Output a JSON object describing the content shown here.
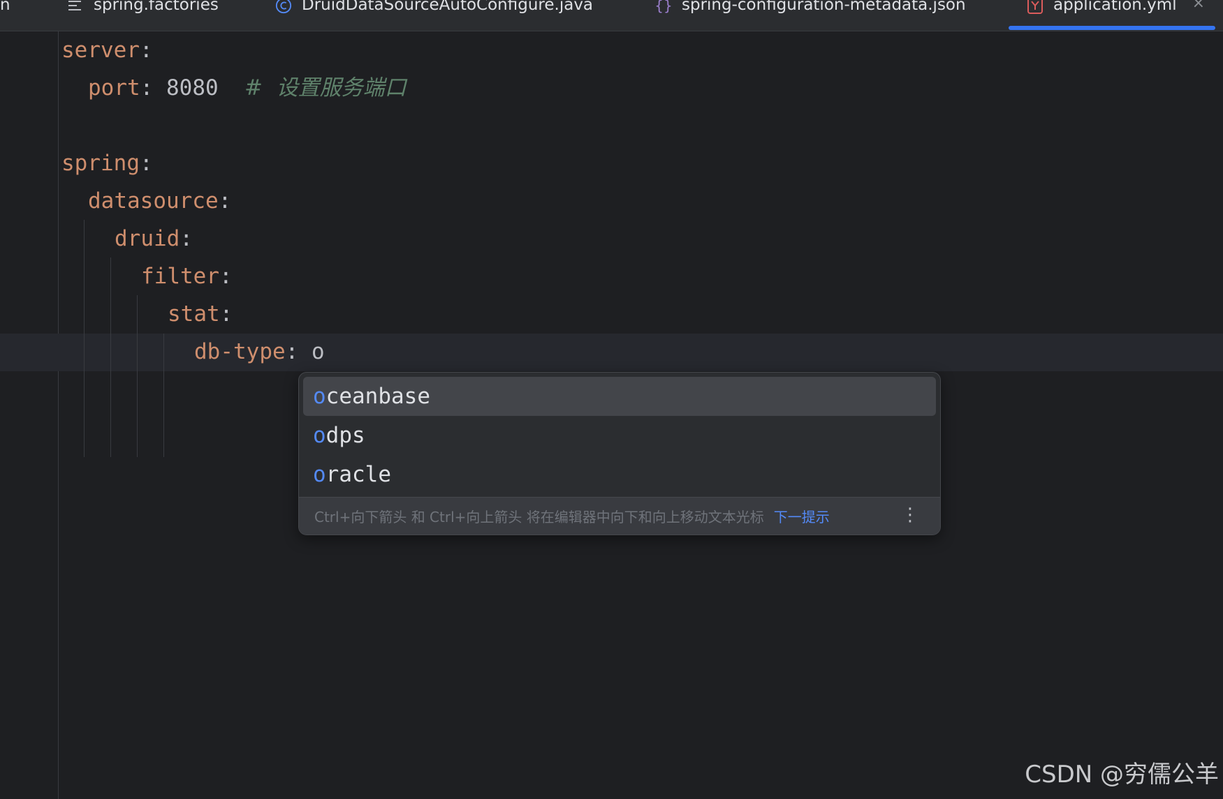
{
  "tabs": [
    {
      "label": "n",
      "icon": "none"
    },
    {
      "label": "spring.factories",
      "icon": "text-file-icon"
    },
    {
      "label": "DruidDataSourceAutoConfigure.java",
      "icon": "java-class-icon"
    },
    {
      "label": "spring-configuration-metadata.json",
      "icon": "json-file-icon"
    },
    {
      "label": "application.yml",
      "icon": "yaml-file-icon",
      "active": true,
      "close": "×"
    }
  ],
  "code": {
    "line1_key": "server",
    "line2_key": "port",
    "line2_value": "8080",
    "line2_comment": "#  设置服务端口",
    "line4_key": "spring",
    "line5_key": "datasource",
    "line6_key": "druid",
    "line7_key": "filter",
    "line8_key": "stat",
    "line9_key": "db-type",
    "line9_value": "o",
    "colon": ":"
  },
  "completion": {
    "items": [
      {
        "match": "o",
        "rest": "ceanbase"
      },
      {
        "match": "o",
        "rest": "dps"
      },
      {
        "match": "o",
        "rest": "racle"
      }
    ],
    "footer_hint": "Ctrl+向下箭头 和 Ctrl+向上箭头 将在编辑器中向下和向上移动文本光标",
    "footer_link": "下一提示",
    "more": "⋮"
  },
  "watermark": "CSDN @穷儒公羊",
  "colors": {
    "background": "#1e1f22",
    "key": "#cf8e6d",
    "comment": "#5f826b",
    "accent": "#3574f0",
    "match": "#548af7"
  }
}
